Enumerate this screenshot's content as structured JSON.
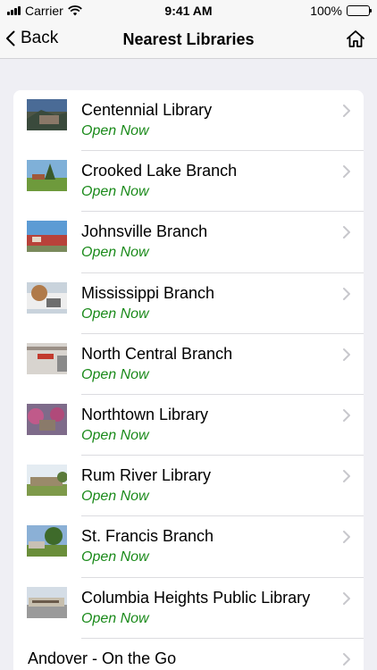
{
  "status_bar": {
    "carrier": "Carrier",
    "time": "9:41 AM",
    "battery": "100%"
  },
  "nav": {
    "back_label": "Back",
    "title": "Nearest Libraries"
  },
  "status_color": "#1a8a1a",
  "libraries": [
    {
      "name": "Centennial Library",
      "status": "Open Now"
    },
    {
      "name": "Crooked Lake Branch",
      "status": "Open Now"
    },
    {
      "name": "Johnsville Branch",
      "status": "Open Now"
    },
    {
      "name": "Mississippi Branch",
      "status": "Open Now"
    },
    {
      "name": "North Central Branch",
      "status": "Open Now"
    },
    {
      "name": "Northtown Library",
      "status": "Open Now"
    },
    {
      "name": "Rum River Library",
      "status": "Open Now"
    },
    {
      "name": "St. Francis Branch",
      "status": "Open Now"
    },
    {
      "name": "Columbia Heights Public Library",
      "status": "Open Now"
    },
    {
      "name": "Andover - On the Go"
    }
  ]
}
